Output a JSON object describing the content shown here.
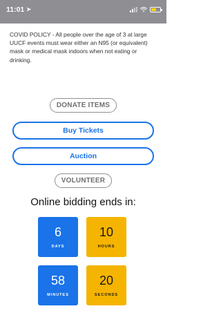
{
  "status_bar": {
    "time": "11:01",
    "battery_level": 0.6,
    "icons": [
      "location-arrow-icon",
      "signal-icon",
      "wifi-icon",
      "battery-icon"
    ]
  },
  "policy_text": "COVID POLICY - All people over the age of 3 at large UUCF events must wear either an N95 (or equivalent) mask or medical mask indoors when not eating or drinking.",
  "buttons": {
    "donate": "DONATE ITEMS",
    "buy_tickets": "Buy Tickets",
    "auction": "Auction",
    "volunteer": "VOLUNTEER"
  },
  "countdown": {
    "title": "Online bidding ends in:",
    "days": {
      "value": "6",
      "label": "DAYS"
    },
    "hours": {
      "value": "10",
      "label": "HOURS"
    },
    "minutes": {
      "value": "58",
      "label": "MINUTES"
    },
    "seconds": {
      "value": "20",
      "label": "SECONDS"
    }
  },
  "colors": {
    "status_bar": "#8e8e93",
    "primary_blue": "#1a73e8",
    "gold": "#f5b400",
    "gray_button": "#8f8f8f"
  }
}
